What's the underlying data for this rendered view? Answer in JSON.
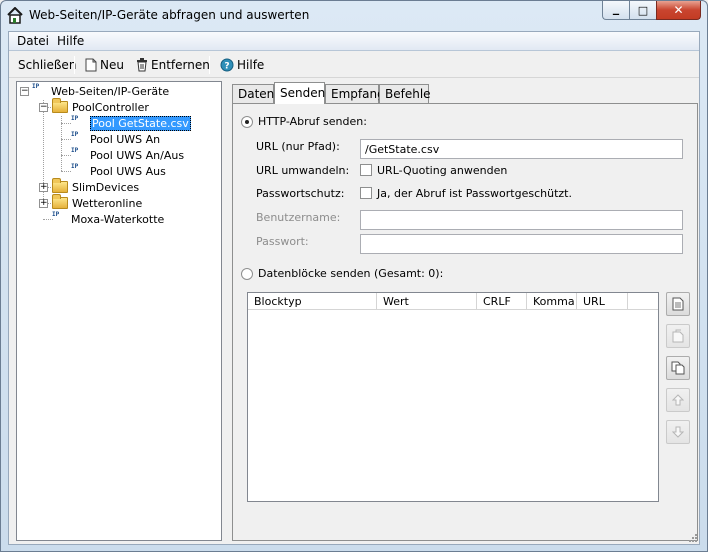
{
  "window": {
    "title": "Web-Seiten/IP-Geräte abfragen und auswerten",
    "caption": {
      "minimize": "▁",
      "maximize": "□",
      "close": "✕"
    }
  },
  "menu": {
    "items": [
      "Datei",
      "Hilfe"
    ]
  },
  "toolbar": {
    "close_label": "Schließen",
    "new_label": "Neu",
    "remove_label": "Entfernen",
    "help_label": "Hilfe"
  },
  "tree": {
    "root": "Web-Seiten/IP-Geräte",
    "pool_controller": "PoolController",
    "pool_children": [
      "Pool GetState.csv",
      "Pool UWS An",
      "Pool UWS An/Aus",
      "Pool UWS Aus"
    ],
    "slim_devices": "SlimDevices",
    "wetteronline": "Wetteronline",
    "moxa": "Moxa-Waterkotte",
    "icon_text": "IP"
  },
  "tabs": [
    "Daten",
    "Senden",
    "Empfang",
    "Befehle"
  ],
  "send": {
    "http_radio_label": "HTTP-Abruf senden:",
    "url_label": "URL (nur Pfad):",
    "url_value": "/GetState.csv",
    "convert_label": "URL umwandeln:",
    "quoting_label": "URL-Quoting anwenden",
    "password_protect_label": "Passwortschutz:",
    "password_check_label": "Ja, der Abruf ist Passwortgeschützt.",
    "username_label": "Benutzername:",
    "username_value": "",
    "password_label": "Passwort:",
    "password_value": "",
    "blocks_radio_label": "Datenblöcke senden (Gesamt: 0):",
    "columns": [
      "Blocktyp",
      "Wert",
      "CRLF",
      "Komma",
      "URL"
    ]
  }
}
